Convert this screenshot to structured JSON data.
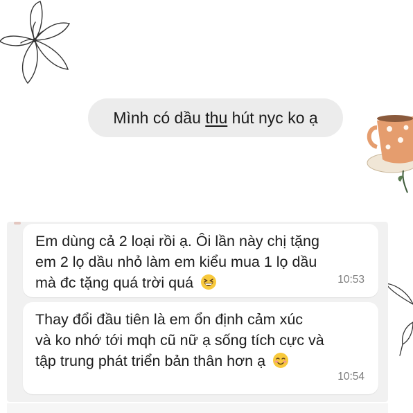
{
  "prompt": {
    "text_before": "Mình có dầu ",
    "text_underlined": "thu",
    "text_after": " hút nyc ko ạ"
  },
  "messages": [
    {
      "lines": [
        "Em dùng cả 2 loại rồi ạ. Ôi lần này chị tặng",
        "em 2 lọ dầu nhỏ làm em kiểu mua 1 lọ dầu",
        "mà đc tặng quá trời quá"
      ],
      "emoji": "grinning-squinting-face",
      "time": "10:53"
    },
    {
      "lines": [
        "Thay đổi đầu tiên là em ổn định cảm xúc",
        "và ko nhớ tới mqh cũ nữ ạ sống tích cực và",
        "tập trung phát triển bản thân hơn ạ"
      ],
      "emoji": "smiling-face",
      "time": "10:54"
    }
  ],
  "colors": {
    "prompt_bubble": "#ececec",
    "chat_background": "#f1f1f1",
    "message_bubble": "#ffffff",
    "timestamp": "#7e7e7e",
    "cup_orange": "#e59d6e"
  }
}
